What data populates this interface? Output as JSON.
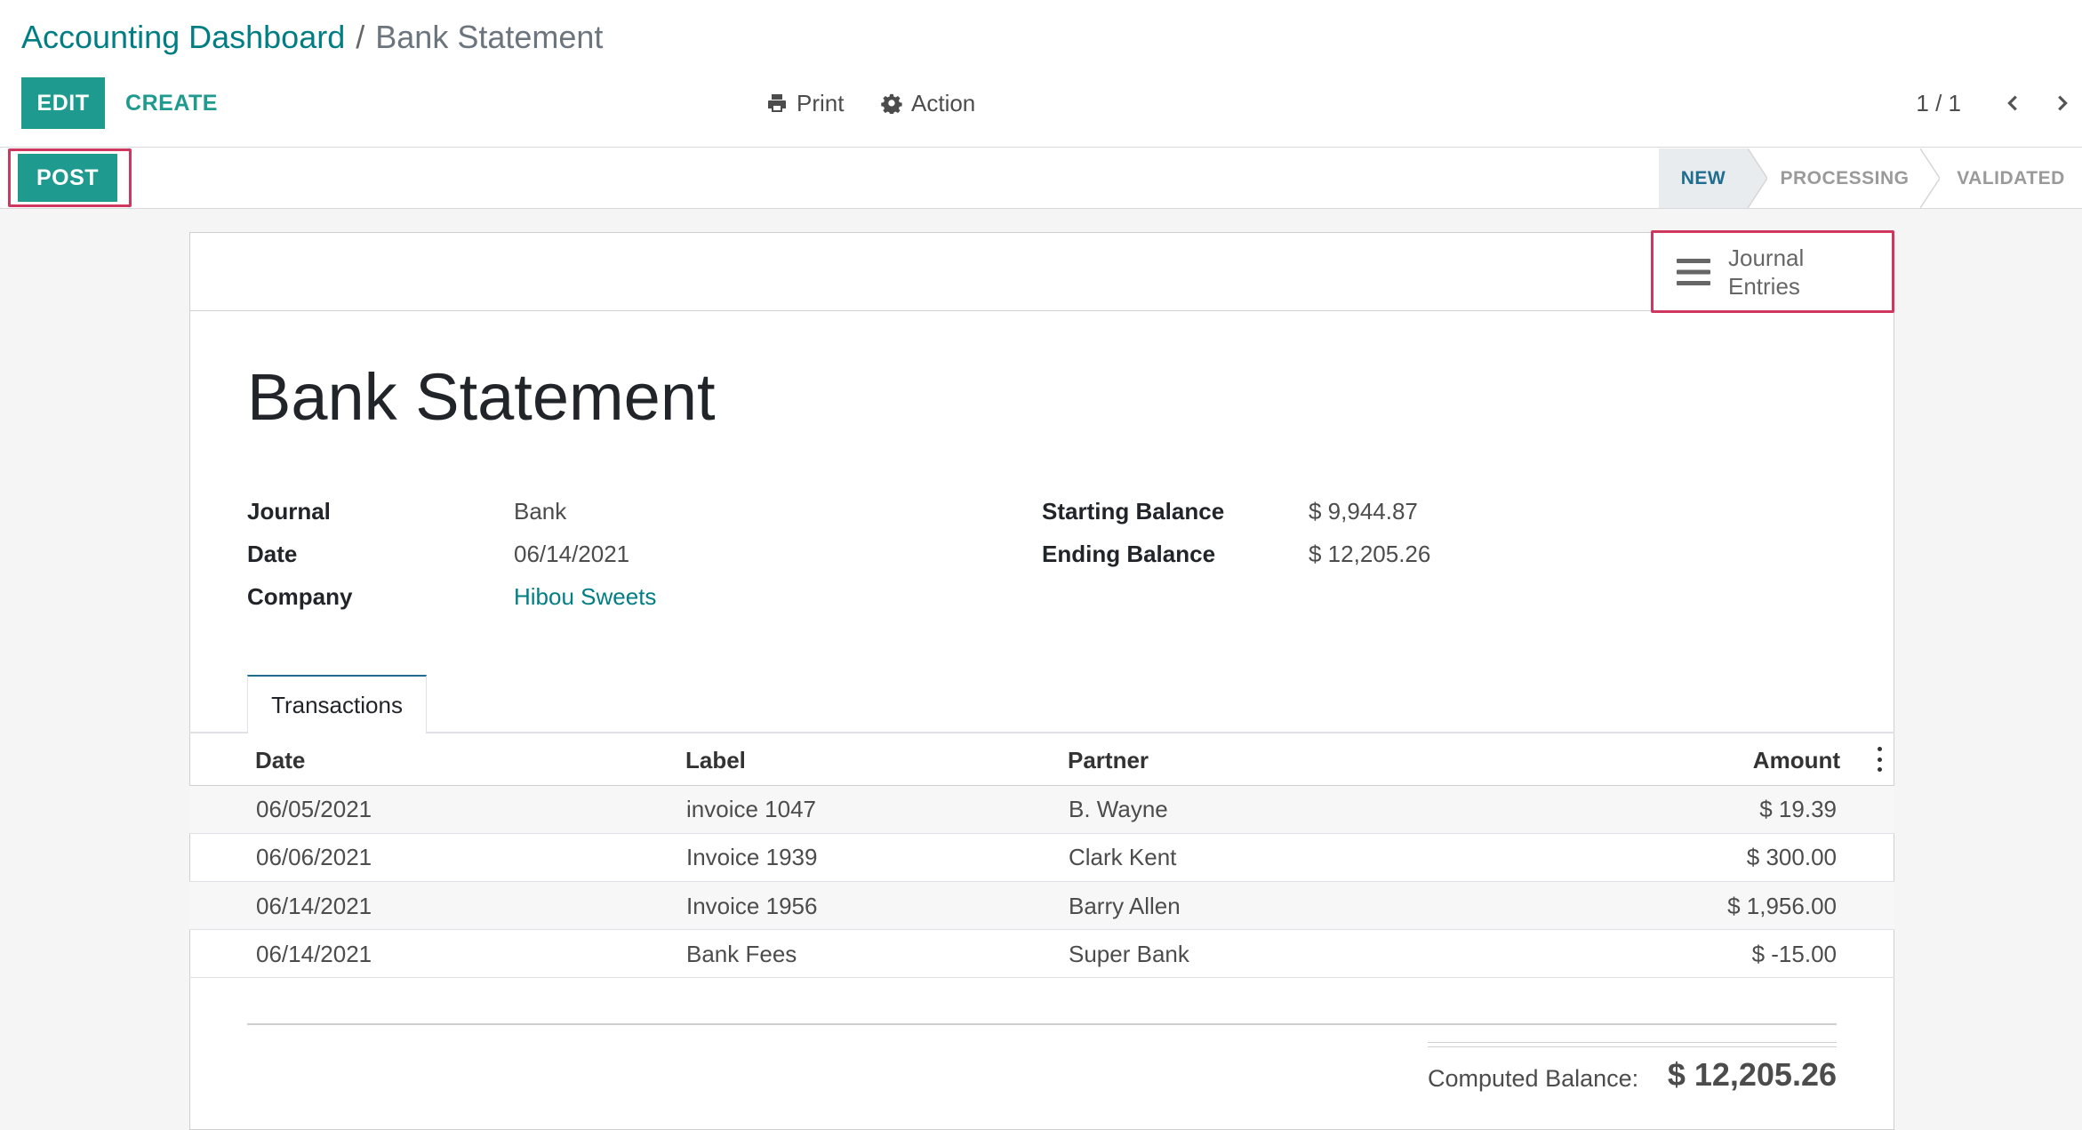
{
  "breadcrumb": {
    "parent": "Accounting Dashboard",
    "separator": "/",
    "current": "Bank Statement"
  },
  "toolbar": {
    "edit_label": "EDIT",
    "create_label": "CREATE",
    "print_label": "Print",
    "action_label": "Action",
    "pager_value": "1 / 1",
    "print_icon": "print-icon",
    "action_icon": "gear-icon"
  },
  "statusbar": {
    "post_label": "POST",
    "stages": [
      "NEW",
      "PROCESSING",
      "VALIDATED"
    ],
    "active_stage": "NEW"
  },
  "smart_button": {
    "icon": "bars-icon",
    "line1": "Journal",
    "line2": "Entries"
  },
  "record": {
    "title": "Bank Statement",
    "fields_left": [
      {
        "label": "Journal",
        "value": "Bank"
      },
      {
        "label": "Date",
        "value": "06/14/2021"
      },
      {
        "label": "Company",
        "value": "Hibou Sweets"
      }
    ],
    "fields_right": [
      {
        "label": "Starting Balance",
        "value": "$ 9,944.87"
      },
      {
        "label": "Ending Balance",
        "value": "$ 12,205.26"
      }
    ]
  },
  "tabs": [
    {
      "label": "Transactions"
    }
  ],
  "transactions": {
    "columns": [
      "Date",
      "Label",
      "Partner",
      "Amount"
    ],
    "rows": [
      {
        "date": "06/05/2021",
        "label": "invoice 1047",
        "partner": "B. Wayne",
        "amount": "$ 19.39"
      },
      {
        "date": "06/06/2021",
        "label": "Invoice 1939",
        "partner": "Clark Kent",
        "amount": "$ 300.00"
      },
      {
        "date": "06/14/2021",
        "label": "Invoice 1956",
        "partner": "Barry Allen",
        "amount": "$ 1,956.00"
      },
      {
        "date": "06/14/2021",
        "label": "Bank Fees",
        "partner": "Super Bank",
        "amount": "$ -15.00"
      }
    ]
  },
  "totals": {
    "computed_balance_label": "Computed Balance:",
    "computed_balance_value": "$ 12,205.26"
  },
  "colors": {
    "primary": "#1e9a8e",
    "link": "#017e84",
    "highlight": "#d0375f",
    "active_stage": "#1f6d8f"
  }
}
